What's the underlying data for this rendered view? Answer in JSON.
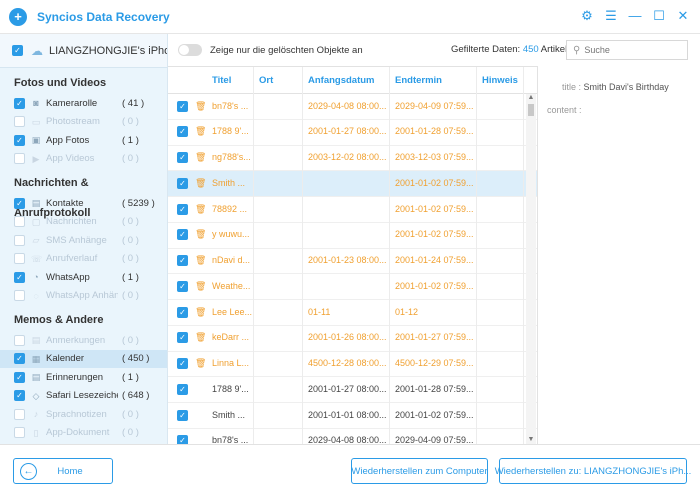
{
  "app": {
    "title": "Syncios Data Recovery",
    "logo_symbol": "+",
    "controls": [
      "settings-icon",
      "menu-icon",
      "minimize-icon",
      "maximize-icon",
      "close-icon"
    ]
  },
  "device": {
    "name": "LIANGZHONGJIE's iPhone"
  },
  "sidebar": {
    "groups": [
      {
        "title": "Fotos und Videos",
        "items": [
          {
            "label": "Kamerarolle",
            "count": "( 41 )",
            "checked": true,
            "disabled": false,
            "icon": "camera-icon"
          },
          {
            "label": "Photostream",
            "count": "( 0 )",
            "checked": false,
            "disabled": true,
            "icon": "photostream-icon"
          },
          {
            "label": "App Fotos",
            "count": "( 1 )",
            "checked": true,
            "disabled": false,
            "icon": "photo-icon"
          },
          {
            "label": "App Videos",
            "count": "( 0 )",
            "checked": false,
            "disabled": true,
            "icon": "video-icon"
          }
        ]
      },
      {
        "title": "Nachrichten & Anrufprotokoll",
        "items": [
          {
            "label": "Kontakte",
            "count": "( 5239 )",
            "checked": true,
            "disabled": false,
            "icon": "contacts-icon"
          },
          {
            "label": "Nachrichten",
            "count": "( 0 )",
            "checked": false,
            "disabled": true,
            "icon": "message-icon"
          },
          {
            "label": "SMS Anhänge",
            "count": "( 0 )",
            "checked": false,
            "disabled": true,
            "icon": "attachment-icon"
          },
          {
            "label": "Anrufverlauf",
            "count": "( 0 )",
            "checked": false,
            "disabled": true,
            "icon": "phone-icon"
          },
          {
            "label": "WhatsApp",
            "count": "( 1 )",
            "checked": true,
            "disabled": false,
            "icon": "whatsapp-icon"
          },
          {
            "label": "WhatsApp Anhän...",
            "count": "( 0 )",
            "checked": false,
            "disabled": true,
            "icon": "whatsapp-attachment-icon"
          }
        ]
      },
      {
        "title": "Memos & Andere",
        "items": [
          {
            "label": "Anmerkungen",
            "count": "( 0 )",
            "checked": false,
            "disabled": true,
            "icon": "notes-icon"
          },
          {
            "label": "Kalender",
            "count": "( 450 )",
            "checked": true,
            "disabled": false,
            "icon": "calendar-icon",
            "selected": true
          },
          {
            "label": "Erinnerungen",
            "count": "( 1 )",
            "checked": true,
            "disabled": false,
            "icon": "reminder-icon"
          },
          {
            "label": "Safari Lesezeichen",
            "count": "( 648 )",
            "checked": true,
            "disabled": false,
            "icon": "bookmark-icon"
          },
          {
            "label": "Sprachnotizen",
            "count": "( 0 )",
            "checked": false,
            "disabled": true,
            "icon": "voice-memo-icon"
          },
          {
            "label": "App-Dokument",
            "count": "( 0 )",
            "checked": false,
            "disabled": true,
            "icon": "document-icon"
          }
        ]
      }
    ]
  },
  "filter": {
    "toggle_label": "Zeige nur die gelöschten Objekte an",
    "count_prefix": "Gefilterte Daten: ",
    "count_value": "450",
    "count_suffix": " Artikel",
    "search_placeholder": "Suche"
  },
  "table": {
    "columns": [
      "Titel",
      "Ort",
      "Anfangsdatum",
      "Endtermin",
      "Hinweis"
    ],
    "rows": [
      {
        "title": "bn78's ...",
        "ort": "",
        "start": "2029-04-08 08:00...",
        "end": "2029-04-09 07:59...",
        "hint": "",
        "deleted": true,
        "selected": false
      },
      {
        "title": "1788 9'...",
        "ort": "",
        "start": "2001-01-27 08:00...",
        "end": "2001-01-28 07:59...",
        "hint": "",
        "deleted": true,
        "selected": false
      },
      {
        "title": "ng788's...",
        "ort": "",
        "start": "2003-12-02 08:00...",
        "end": "2003-12-03 07:59...",
        "hint": "",
        "deleted": true,
        "selected": false
      },
      {
        "title": "Smith ...",
        "ort": "",
        "start": "",
        "end": "2001-01-02 07:59...",
        "hint": "",
        "deleted": true,
        "selected": true
      },
      {
        "title": "78892 ...",
        "ort": "",
        "start": "",
        "end": "2001-01-02 07:59...",
        "hint": "",
        "deleted": true,
        "selected": false
      },
      {
        "title": "y wuwu...",
        "ort": "",
        "start": "",
        "end": "2001-01-02 07:59...",
        "hint": "",
        "deleted": true,
        "selected": false
      },
      {
        "title": "nDavi d...",
        "ort": "",
        "start": "2001-01-23 08:00...",
        "end": "2001-01-24 07:59...",
        "hint": "",
        "deleted": true,
        "selected": false
      },
      {
        "title": "Weathe...",
        "ort": "",
        "start": "",
        "end": "2001-01-02 07:59...",
        "hint": "",
        "deleted": true,
        "selected": false
      },
      {
        "title": "Lee Lee...",
        "ort": "",
        "start": "01-11",
        "end": "01-12",
        "hint": "",
        "deleted": true,
        "selected": false
      },
      {
        "title": "keDarr ...",
        "ort": "",
        "start": "2001-01-26 08:00...",
        "end": "2001-01-27 07:59...",
        "hint": "",
        "deleted": true,
        "selected": false
      },
      {
        "title": "Linna L...",
        "ort": "",
        "start": "4500-12-28 08:00...",
        "end": "4500-12-29 07:59...",
        "hint": "",
        "deleted": true,
        "selected": false
      },
      {
        "title": "1788 9'...",
        "ort": "",
        "start": "2001-01-27 08:00...",
        "end": "2001-01-28 07:59...",
        "hint": "",
        "deleted": false,
        "selected": false
      },
      {
        "title": "Smith ...",
        "ort": "",
        "start": "2001-01-01 08:00...",
        "end": "2001-01-02 07:59...",
        "hint": "",
        "deleted": false,
        "selected": false
      },
      {
        "title": "bn78's ...",
        "ort": "",
        "start": "2029-04-08 08:00...",
        "end": "2029-04-09 07:59...",
        "hint": "",
        "deleted": false,
        "selected": false
      }
    ]
  },
  "detail": {
    "title_label": "title : ",
    "title_value": "Smith Davi's Birthday",
    "content_label": "content :"
  },
  "buttons": {
    "home": "Home",
    "restore_computer": "Wiederherstellen zum Computer",
    "restore_device": "Wiederherstellen zu: LIANGZHONGJIE's iPh..."
  },
  "colors": {
    "accent": "#2b9be6",
    "deleted": "#f0a030",
    "sidebar_bg": "#eaf5fc",
    "selected_row": "#dceefa"
  }
}
